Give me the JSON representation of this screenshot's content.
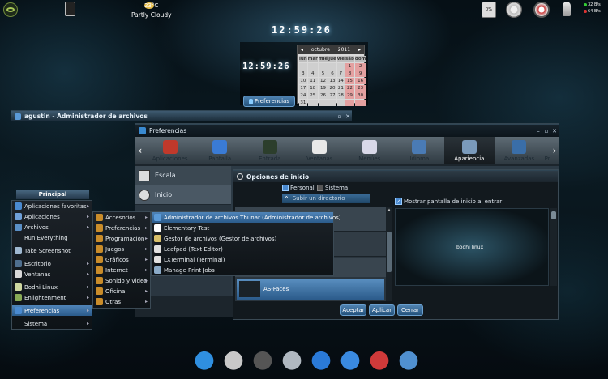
{
  "top_bar": {
    "weather_temp": "23°C",
    "weather_label": "Partly Cloudy",
    "battery_percent": "0%",
    "net_up": "32 B/s",
    "net_down": "64 B/s"
  },
  "desktop": {
    "clock_time": "12:59:26",
    "clock_time_small": "12:59:26",
    "preferencias_button": "Preferencias"
  },
  "calendar": {
    "month": "octubre",
    "year": "2011",
    "weekdays": [
      "lun",
      "mar",
      "mié",
      "jue",
      "vie",
      "sáb",
      "dom"
    ],
    "days": [
      "",
      "",
      "",
      "",
      "",
      "1",
      "2",
      "3",
      "4",
      "5",
      "6",
      "7",
      "8",
      "9",
      "10",
      "11",
      "12",
      "13",
      "14",
      "15",
      "16",
      "17",
      "18",
      "19",
      "20",
      "21",
      "22",
      "23",
      "24",
      "25",
      "26",
      "27",
      "28",
      "29",
      "30",
      "31",
      "",
      "",
      "",
      "",
      "",
      ""
    ]
  },
  "file_manager": {
    "title": "agustin - Administrador de archivos"
  },
  "prefs_window": {
    "title": "Preferencias",
    "tools": [
      {
        "label": "Aplicaciones",
        "icon": "apps-icon",
        "color": "#c0392b"
      },
      {
        "label": "Pantalla",
        "icon": "display-icon",
        "color": "#3a7bd5"
      },
      {
        "label": "Entrada",
        "icon": "keyboard-icon",
        "color": "#2c3e2c"
      },
      {
        "label": "Ventanas",
        "icon": "window-icon",
        "color": "#e8e8e8"
      },
      {
        "label": "Menúes",
        "icon": "menu-icon",
        "color": "#d8d8e8"
      },
      {
        "label": "Idioma",
        "icon": "language-icon",
        "color": "#4a7bb5"
      },
      {
        "label": "Apariencia",
        "icon": "appearance-icon",
        "color": "#7a9abb"
      },
      {
        "label": "Avanzadas",
        "icon": "advanced-icon",
        "color": "#3a6ea8"
      }
    ],
    "tool_overflow": "Pr",
    "list_items": [
      "Escala",
      "Inicio"
    ]
  },
  "startup_dialog": {
    "title": "Opciones de inicio",
    "radio_personal": "Personal",
    "radio_sistema": "Sistema",
    "up_dir": "Subir un directorio",
    "checkbox_label": "Mostrar pantalla de inicio al entrar",
    "selected_theme": "AS-Faces",
    "preview_text": "bodhi linux",
    "buttons": [
      "Aceptar",
      "Aplicar",
      "Cerrar"
    ]
  },
  "main_menu": {
    "title": "Principal",
    "items": [
      {
        "label": "Aplicaciones favoritas",
        "arrow": true,
        "icon": "star-icon",
        "color": "#4a8ad0"
      },
      {
        "label": "Aplicaciones",
        "arrow": true,
        "icon": "apps-icon",
        "color": "#6fa0d8"
      },
      {
        "label": "Archivos",
        "arrow": true,
        "icon": "folder-icon",
        "color": "#5a8fc5"
      },
      {
        "label": "Run Everything",
        "arrow": false,
        "icon": "",
        "color": ""
      },
      {
        "label": "Take Screenshot",
        "arrow": false,
        "icon": "camera-icon",
        "color": "#9fb8d0"
      },
      {
        "label": "Escritorio",
        "arrow": true,
        "icon": "desktop-icon",
        "color": "#4f6f8f"
      },
      {
        "label": "Ventanas",
        "arrow": true,
        "icon": "window-icon",
        "color": "#d9d9d9"
      },
      {
        "label": "Bodhi Linux",
        "arrow": true,
        "icon": "bodhi-icon",
        "color": "#cfd8a0"
      },
      {
        "label": "Enlightenment",
        "arrow": true,
        "icon": "enlightenment-icon",
        "color": "#88aa55"
      },
      {
        "label": "Preferencias",
        "arrow": true,
        "icon": "preferences-icon",
        "color": "#4a8ad0"
      },
      {
        "label": "Sistema",
        "arrow": true,
        "icon": "",
        "color": ""
      }
    ],
    "selected_index": 9
  },
  "apps_submenu": {
    "items": [
      {
        "label": "Accesorios",
        "icon": "accessories-icon",
        "color": "#c98c2a"
      },
      {
        "label": "Preferencias",
        "icon": "preferences-icon",
        "color": "#c98c2a"
      },
      {
        "label": "Programación",
        "icon": "programming-icon",
        "color": "#c98c2a"
      },
      {
        "label": "Juegos",
        "icon": "games-icon",
        "color": "#c98c2a"
      },
      {
        "label": "Gráficos",
        "icon": "graphics-icon",
        "color": "#c98c2a"
      },
      {
        "label": "Internet",
        "icon": "internet-icon",
        "color": "#c98c2a"
      },
      {
        "label": "Sonido y video",
        "icon": "sound-video-icon",
        "color": "#c98c2a"
      },
      {
        "label": "Oficina",
        "icon": "office-icon",
        "color": "#c98c2a"
      },
      {
        "label": "Otras",
        "icon": "other-icon",
        "color": "#c98c2a"
      }
    ]
  },
  "accessories_submenu": {
    "items": [
      {
        "label": "Administrador de archivos Thunar (Administrador de archivos)",
        "icon": "file-manager-icon",
        "color": "#5a9ad8"
      },
      {
        "label": "Elementary Test",
        "icon": "elementary-icon",
        "color": "#ffffff"
      },
      {
        "label": "Gestor de archivos (Gestor de archivos)",
        "icon": "file-manager-icon",
        "color": "#d8c06a"
      },
      {
        "label": "Leafpad (Text Editor)",
        "icon": "text-editor-icon",
        "color": "#e0e0e0"
      },
      {
        "label": "LXTerminal (Terminal)",
        "icon": "terminal-icon",
        "color": "#e0e0e0"
      },
      {
        "label": "Manage Print Jobs",
        "icon": "printer-icon",
        "color": "#8aaac8"
      }
    ],
    "selected_index": 0
  },
  "dock": [
    {
      "icon": "chair-icon",
      "color": "#2f8fe0"
    },
    {
      "icon": "tools-icon",
      "color": "#c8c8c8"
    },
    {
      "icon": "media-player-icon",
      "color": "#555555"
    },
    {
      "icon": "mail-icon",
      "color": "#b0b8c0"
    },
    {
      "icon": "globe-icon",
      "color": "#2a7ad8"
    },
    {
      "icon": "compass-icon",
      "color": "#3a8ae0"
    },
    {
      "icon": "users-icon",
      "color": "#d03a3a"
    },
    {
      "icon": "lock-icon",
      "color": "#5090d0"
    }
  ]
}
